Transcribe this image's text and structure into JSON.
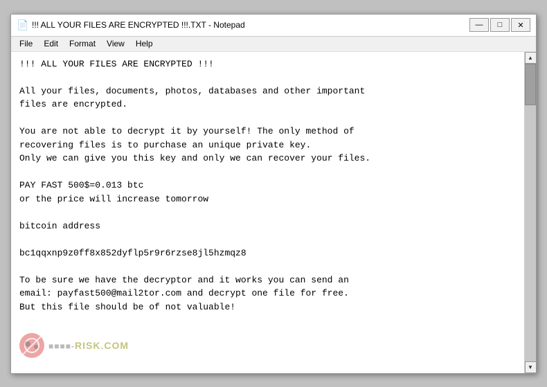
{
  "window": {
    "title": "!!! ALL YOUR FILES ARE ENCRYPTED !!!.TXT - Notepad",
    "icon": "📄"
  },
  "titlebar": {
    "minimize_label": "—",
    "maximize_label": "□",
    "close_label": "✕"
  },
  "menu": {
    "items": [
      "File",
      "Edit",
      "Format",
      "View",
      "Help"
    ]
  },
  "content": {
    "text": "!!! ALL YOUR FILES ARE ENCRYPTED !!!\n\nAll your files, documents, photos, databases and other important\nfiles are encrypted.\n\nYou are not able to decrypt it by yourself! The only method of\nrecovering files is to purchase an unique private key.\nOnly we can give you this key and only we can recover your files.\n\nPAY FAST 500$=0.013 btc\nor the price will increase tomorrow\n\nbitcoin address\n\nbc1qqxnp9z0ff8x852dyflp5r9r6rzse8jl5hzmqz8\n\nTo be sure we have the decryptor and it works you can send an\nemail: payfast500@mail2tor.com and decrypt one file for free.\nBut this file should be of not valuable!"
  },
  "watermark": {
    "text": "RISK.COM"
  }
}
